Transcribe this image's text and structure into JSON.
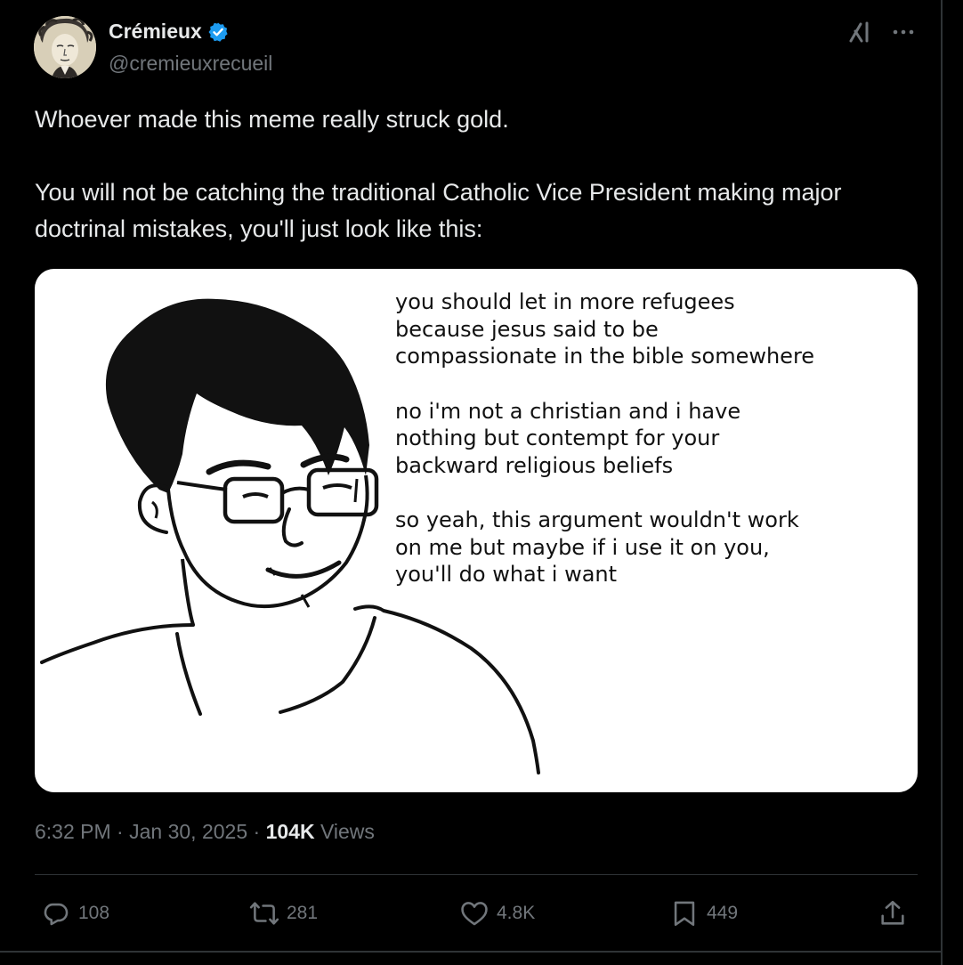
{
  "author": {
    "display_name": "Crémieux",
    "handle": "@cremieuxrecueil",
    "verified_color": "#1d9bf0",
    "avatar_icon": "avatar-illustration"
  },
  "header_icons": [
    "grok-icon",
    "more-icon"
  ],
  "tweet": {
    "paragraphs": [
      "Whoever made this meme really struck gold.",
      "You will not be catching the traditional Catholic Vice President making major doctrinal mistakes, you'll just look like this:"
    ]
  },
  "media": {
    "meme_paragraphs": [
      [
        "you should let in more refugees",
        "because jesus said to be",
        "compassionate in the bible somewhere"
      ],
      [
        "no i'm not a christian and i have",
        "nothing but contempt for your",
        "backward religious beliefs"
      ],
      [
        "so yeah, this argument wouldn't work",
        "on me but maybe if i use it on you,",
        "you'll do what i want"
      ]
    ]
  },
  "meta": {
    "time": "6:32 PM",
    "separator": "·",
    "date": "Jan 30, 2025",
    "views_count": "104K",
    "views_label": "Views"
  },
  "actions": {
    "replies": "108",
    "reposts": "281",
    "likes": "4.8K",
    "bookmarks": "449"
  },
  "colors": {
    "background": "#000000",
    "text": "#e7e9ea",
    "muted": "#71767b",
    "border": "#2f3336",
    "accent": "#1d9bf0"
  }
}
